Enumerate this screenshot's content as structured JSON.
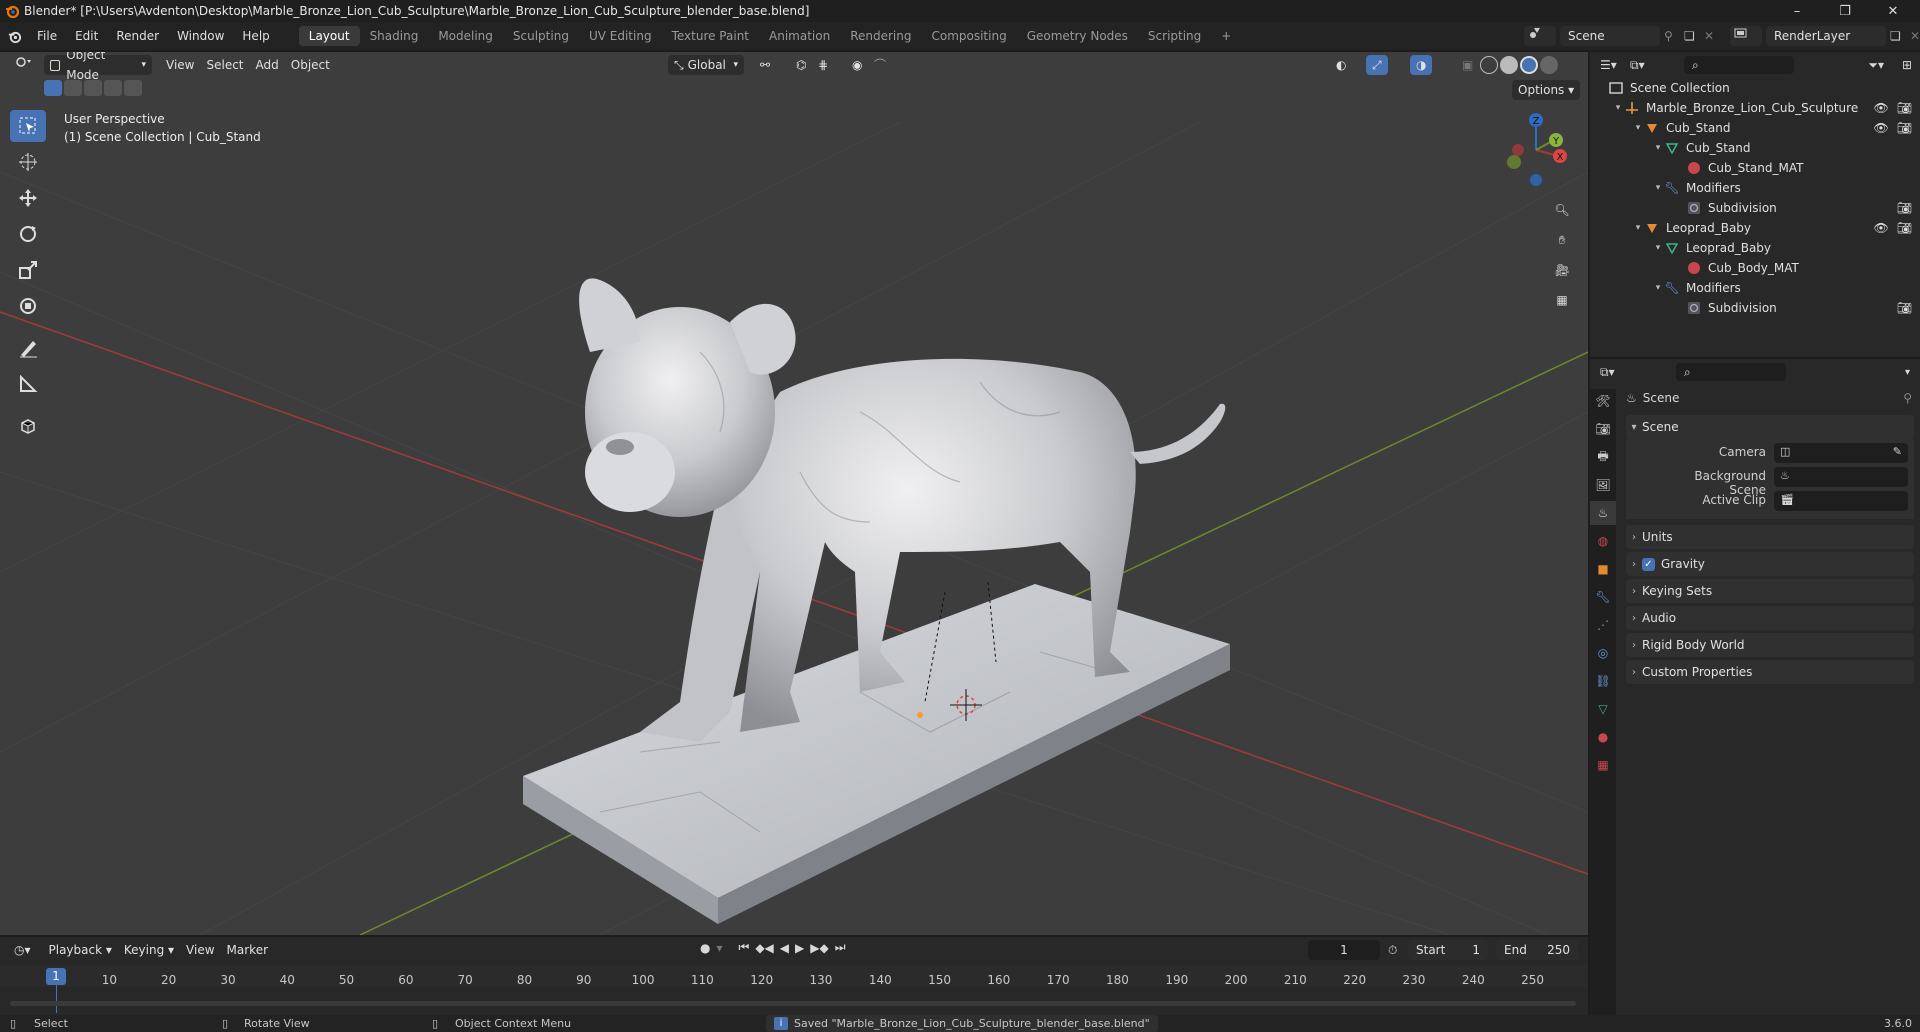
{
  "window": {
    "title": "Blender* [P:\\Users\\Avdenton\\Desktop\\Marble_Bronze_Lion_Cub_Sculpture\\Marble_Bronze_Lion_Cub_Sculpture_blender_base.blend]",
    "controls": [
      "–",
      "❐",
      "✕"
    ]
  },
  "menubar": {
    "menus": [
      "File",
      "Edit",
      "Render",
      "Window",
      "Help"
    ],
    "workspaces": [
      "Layout",
      "Shading",
      "Modeling",
      "Sculpting",
      "UV Editing",
      "Texture Paint",
      "Animation",
      "Rendering",
      "Compositing",
      "Geometry Nodes",
      "Scripting"
    ],
    "active_workspace": "Layout",
    "add_tab": "+",
    "scene": "Scene",
    "view_layer": "RenderLayer"
  },
  "viewport": {
    "mode": "Object Mode",
    "menus": [
      "View",
      "Select",
      "Add",
      "Object"
    ],
    "transform_orientation": "Global",
    "options_label": "Options",
    "overlay_text_line1": "User Perspective",
    "overlay_text_line2": "(1) Scene Collection | Cub_Stand",
    "gizmo_axes": [
      "X",
      "Y",
      "Z"
    ],
    "colors": {
      "bg": "#3d3d3d",
      "grid": "#454545",
      "x_axis": "#a33a3a",
      "y_axis": "#6c8a2c",
      "accent": "#4772b3"
    }
  },
  "outliner": {
    "search_placeholder": "",
    "rows": [
      {
        "label": "Scene Collection",
        "icon": "collection-icon",
        "level": 0,
        "expand": ""
      },
      {
        "label": "Marble_Bronze_Lion_Cub_Sculpture",
        "icon": "empty-icon",
        "level": 1,
        "expand": "▾"
      },
      {
        "label": "Cub_Stand",
        "icon": "mesh-object-icon",
        "level": 2,
        "expand": "▾"
      },
      {
        "label": "Cub_Stand",
        "icon": "mesh-data-icon",
        "level": 3,
        "expand": "▾"
      },
      {
        "label": "Cub_Stand_MAT",
        "icon": "material-icon",
        "level": 4,
        "expand": ""
      },
      {
        "label": "Modifiers",
        "icon": "wrench-icon",
        "level": 3,
        "expand": "▾"
      },
      {
        "label": "Subdivision",
        "icon": "subdivision-icon",
        "level": 4,
        "expand": ""
      },
      {
        "label": "Leoprad_Baby",
        "icon": "mesh-object-icon",
        "level": 2,
        "expand": "▾"
      },
      {
        "label": "Leoprad_Baby",
        "icon": "mesh-data-icon",
        "level": 3,
        "expand": "▾"
      },
      {
        "label": "Cub_Body_MAT",
        "icon": "material-icon",
        "level": 4,
        "expand": ""
      },
      {
        "label": "Modifiers",
        "icon": "wrench-icon",
        "level": 3,
        "expand": "▾"
      },
      {
        "label": "Subdivision",
        "icon": "subdivision-icon",
        "level": 4,
        "expand": ""
      }
    ]
  },
  "properties": {
    "context": "Scene",
    "scene_panel": {
      "title": "Scene",
      "fields": [
        {
          "label": "Camera"
        },
        {
          "label": "Background Scene"
        },
        {
          "label": "Active Clip"
        }
      ]
    },
    "panels": [
      "Units",
      "Gravity",
      "Keying Sets",
      "Audio",
      "Rigid Body World",
      "Custom Properties"
    ],
    "gravity_checked": true
  },
  "timeline": {
    "menus": [
      "Playback",
      "Keying",
      "View",
      "Marker"
    ],
    "current_frame": "1",
    "start_label": "Start",
    "start": "1",
    "end_label": "End",
    "end": "250",
    "ruler": [
      "1",
      "10",
      "20",
      "30",
      "40",
      "50",
      "60",
      "70",
      "80",
      "90",
      "100",
      "110",
      "120",
      "130",
      "140",
      "150",
      "160",
      "170",
      "180",
      "190",
      "200",
      "210",
      "220",
      "230",
      "240",
      "250"
    ]
  },
  "statusbar": {
    "select": "Select",
    "rotate": "Rotate View",
    "context_menu": "Object Context Menu",
    "message": "Saved \"Marble_Bronze_Lion_Cub_Sculpture_blender_base.blend\"",
    "version": "3.6.0"
  }
}
